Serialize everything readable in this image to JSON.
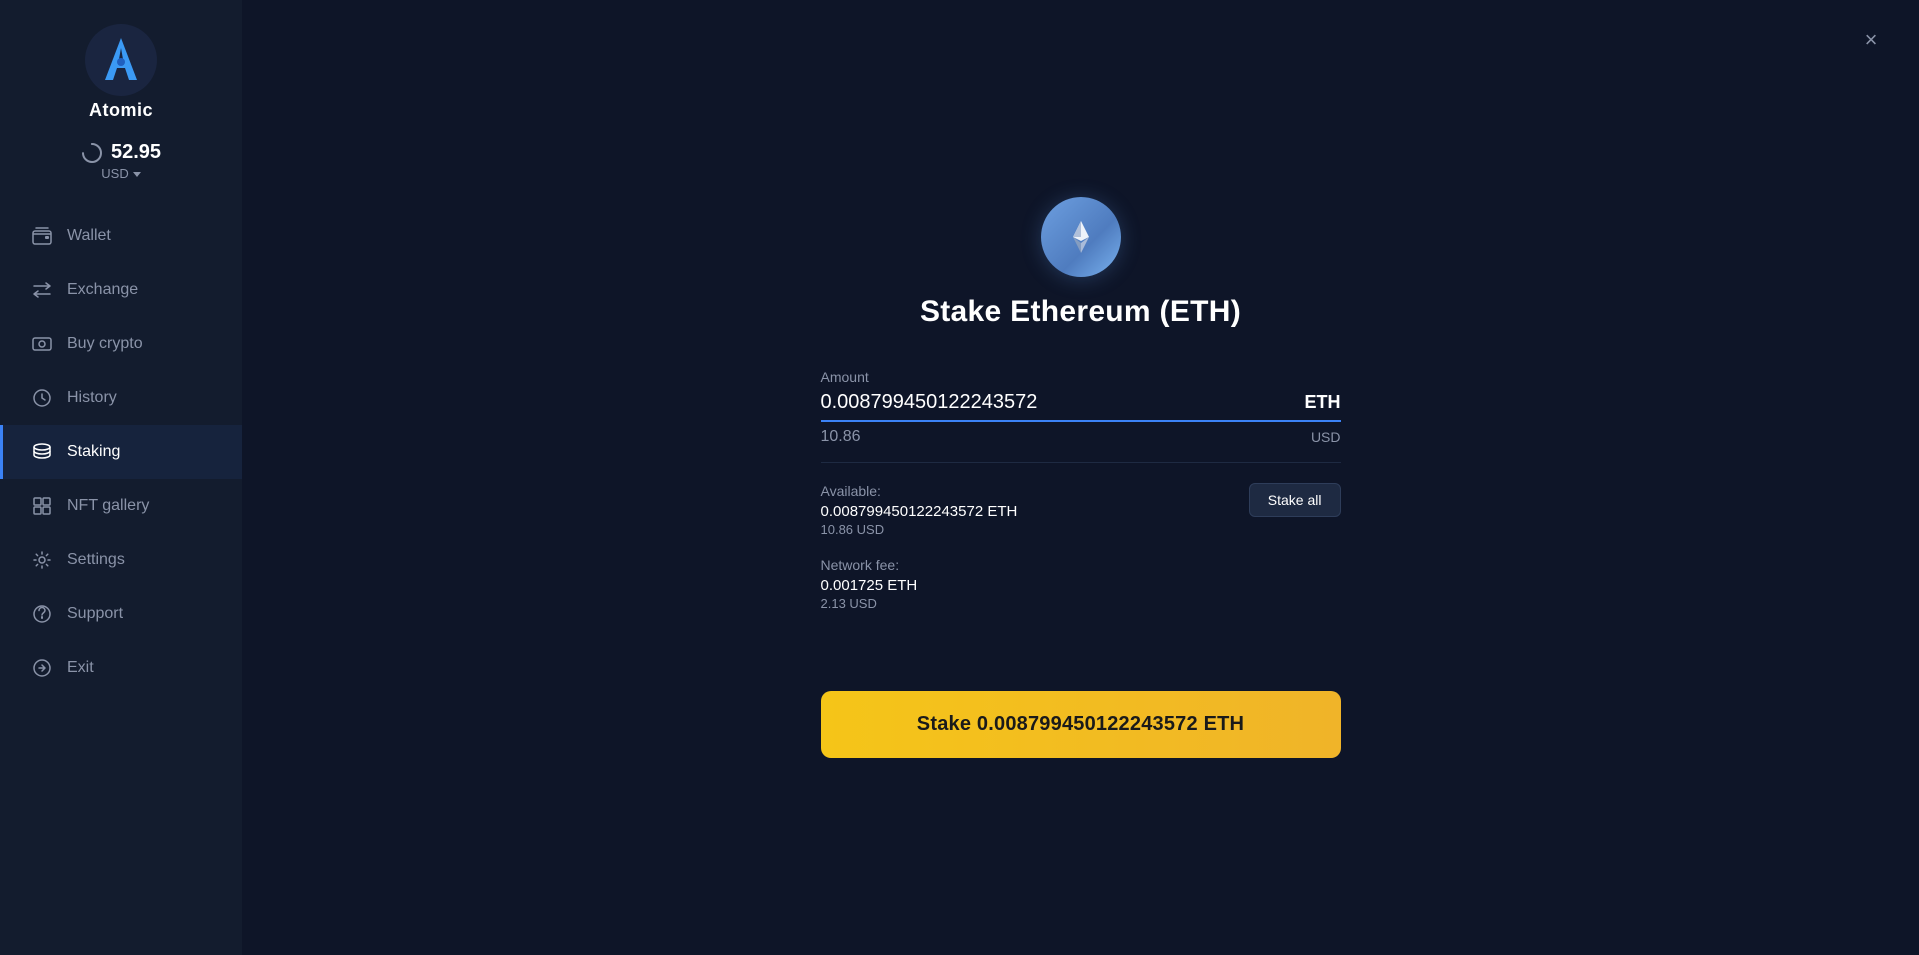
{
  "sidebar": {
    "logo_label": "Atomic",
    "balance": "52.95",
    "currency": "USD",
    "nav_items": [
      {
        "id": "wallet",
        "label": "Wallet",
        "icon": "wallet-icon",
        "active": false
      },
      {
        "id": "exchange",
        "label": "Exchange",
        "icon": "exchange-icon",
        "active": false
      },
      {
        "id": "buy-crypto",
        "label": "Buy crypto",
        "icon": "buy-crypto-icon",
        "active": false
      },
      {
        "id": "history",
        "label": "History",
        "icon": "history-icon",
        "active": false
      },
      {
        "id": "staking",
        "label": "Staking",
        "icon": "staking-icon",
        "active": true
      },
      {
        "id": "nft-gallery",
        "label": "NFT gallery",
        "icon": "nft-icon",
        "active": false
      },
      {
        "id": "settings",
        "label": "Settings",
        "icon": "settings-icon",
        "active": false
      },
      {
        "id": "support",
        "label": "Support",
        "icon": "support-icon",
        "active": false
      },
      {
        "id": "exit",
        "label": "Exit",
        "icon": "exit-icon",
        "active": false
      }
    ]
  },
  "main": {
    "page_title": "Stake Ethereum (ETH)",
    "amount_label": "Amount",
    "amount_value": "0.008799450122243572",
    "amount_currency": "ETH",
    "amount_usd": "10.86",
    "amount_usd_label": "USD",
    "available_label": "Available:",
    "available_eth": "0.008799450122243572 ETH",
    "available_usd": "10.86 USD",
    "stake_all_label": "Stake all",
    "network_fee_label": "Network fee:",
    "network_fee_eth": "0.001725 ETH",
    "network_fee_usd": "2.13 USD",
    "stake_button_label": "Stake 0.008799450122243572 ETH",
    "close_label": "×"
  }
}
